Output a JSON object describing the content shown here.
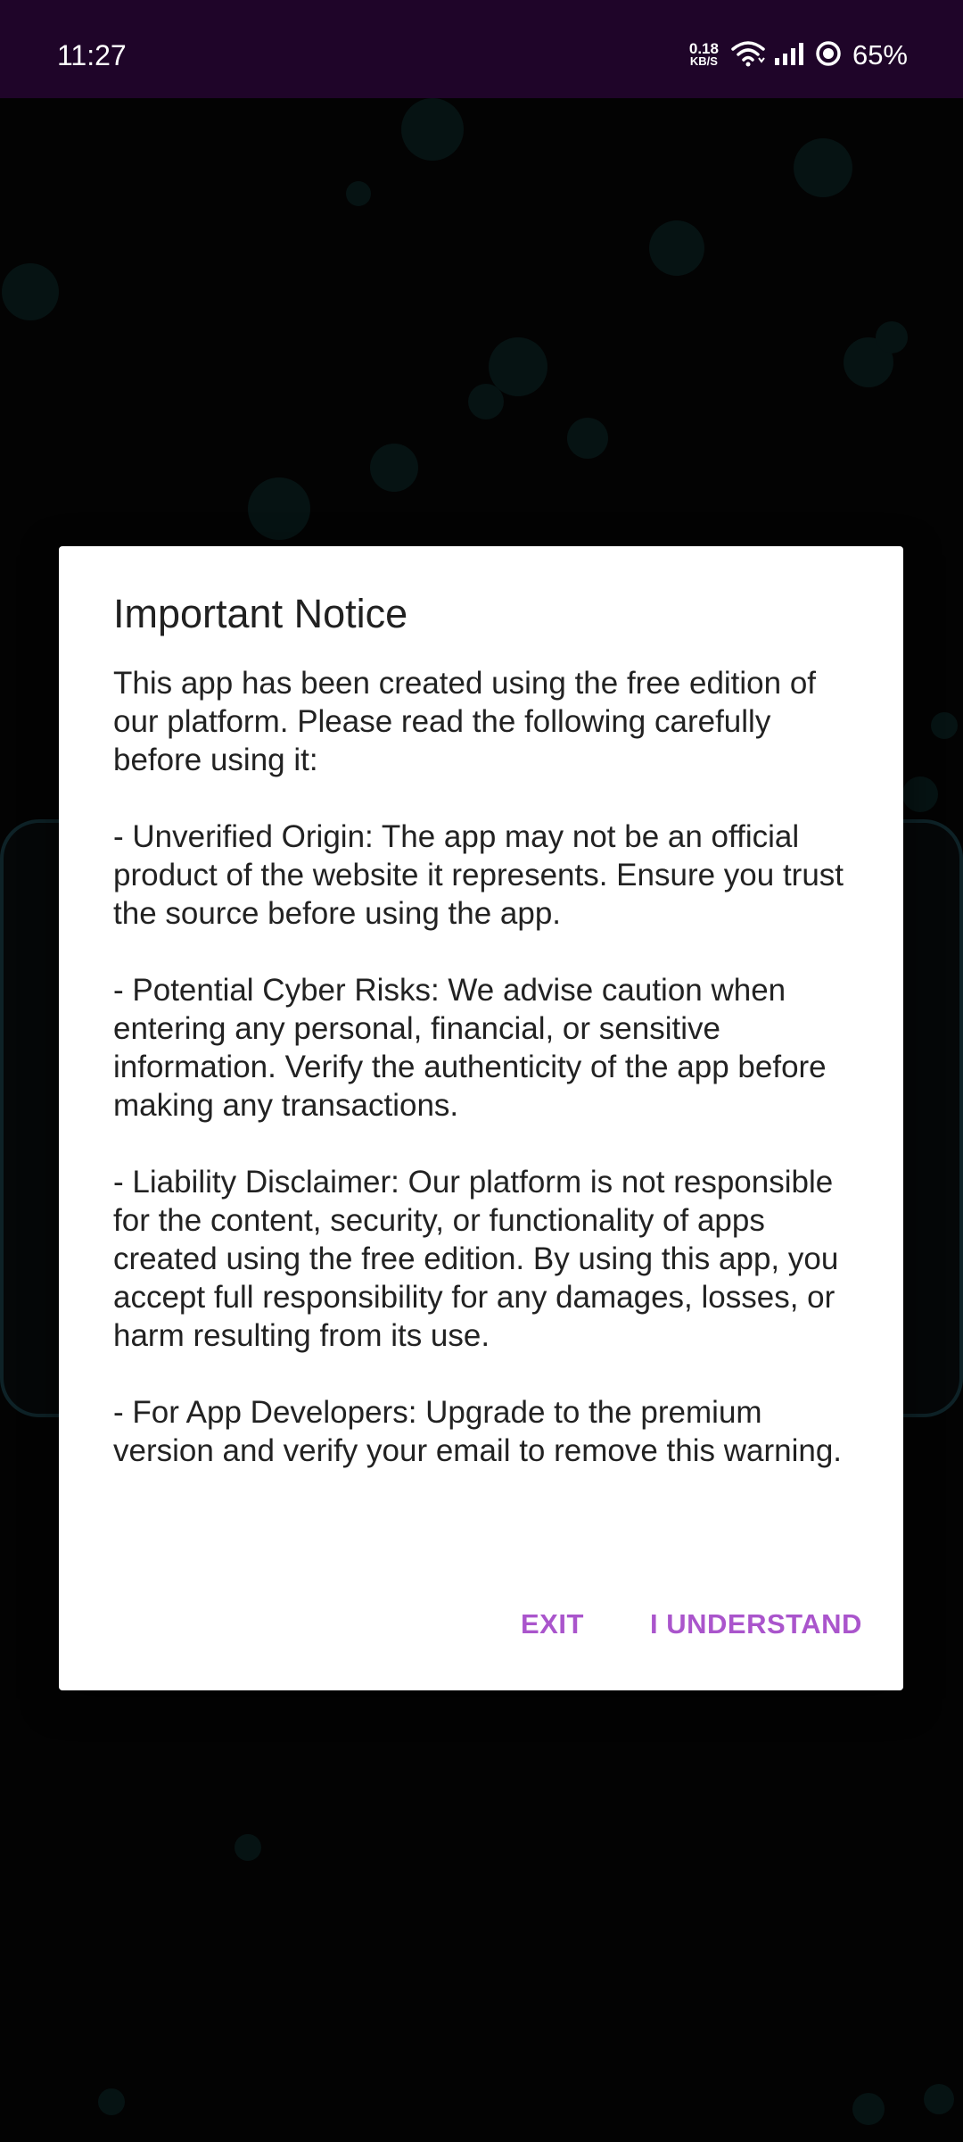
{
  "status_bar": {
    "time": "11:27",
    "net_speed_value": "0.18",
    "net_speed_unit": "KB/S",
    "battery_percent": "65%"
  },
  "dialog": {
    "title": "Important Notice",
    "paragraphs": [
      "This app has been created using the free edition of our platform. Please read the following carefully before using it:",
      "- Unverified Origin: The app may not be an official product of the website it represents. Ensure you trust the source before using the app.",
      "- Potential Cyber Risks: We advise caution when entering any personal, financial, or sensitive information. Verify the authenticity of the app before making any transactions.",
      "- Liability Disclaimer: Our platform is not responsible for the content, security, or functionality of apps created using the free edition. By using this app, you accept full responsibility for any damages, losses, or harm resulting from its use.",
      "- For App Developers: Upgrade to the premium version and verify your email to remove this warning."
    ],
    "exit_label": "EXIT",
    "understand_label": "I UNDERSTAND"
  },
  "colors": {
    "status_bar_bg": "#1f0529",
    "accent": "#aa55cc",
    "background": "#070707"
  }
}
